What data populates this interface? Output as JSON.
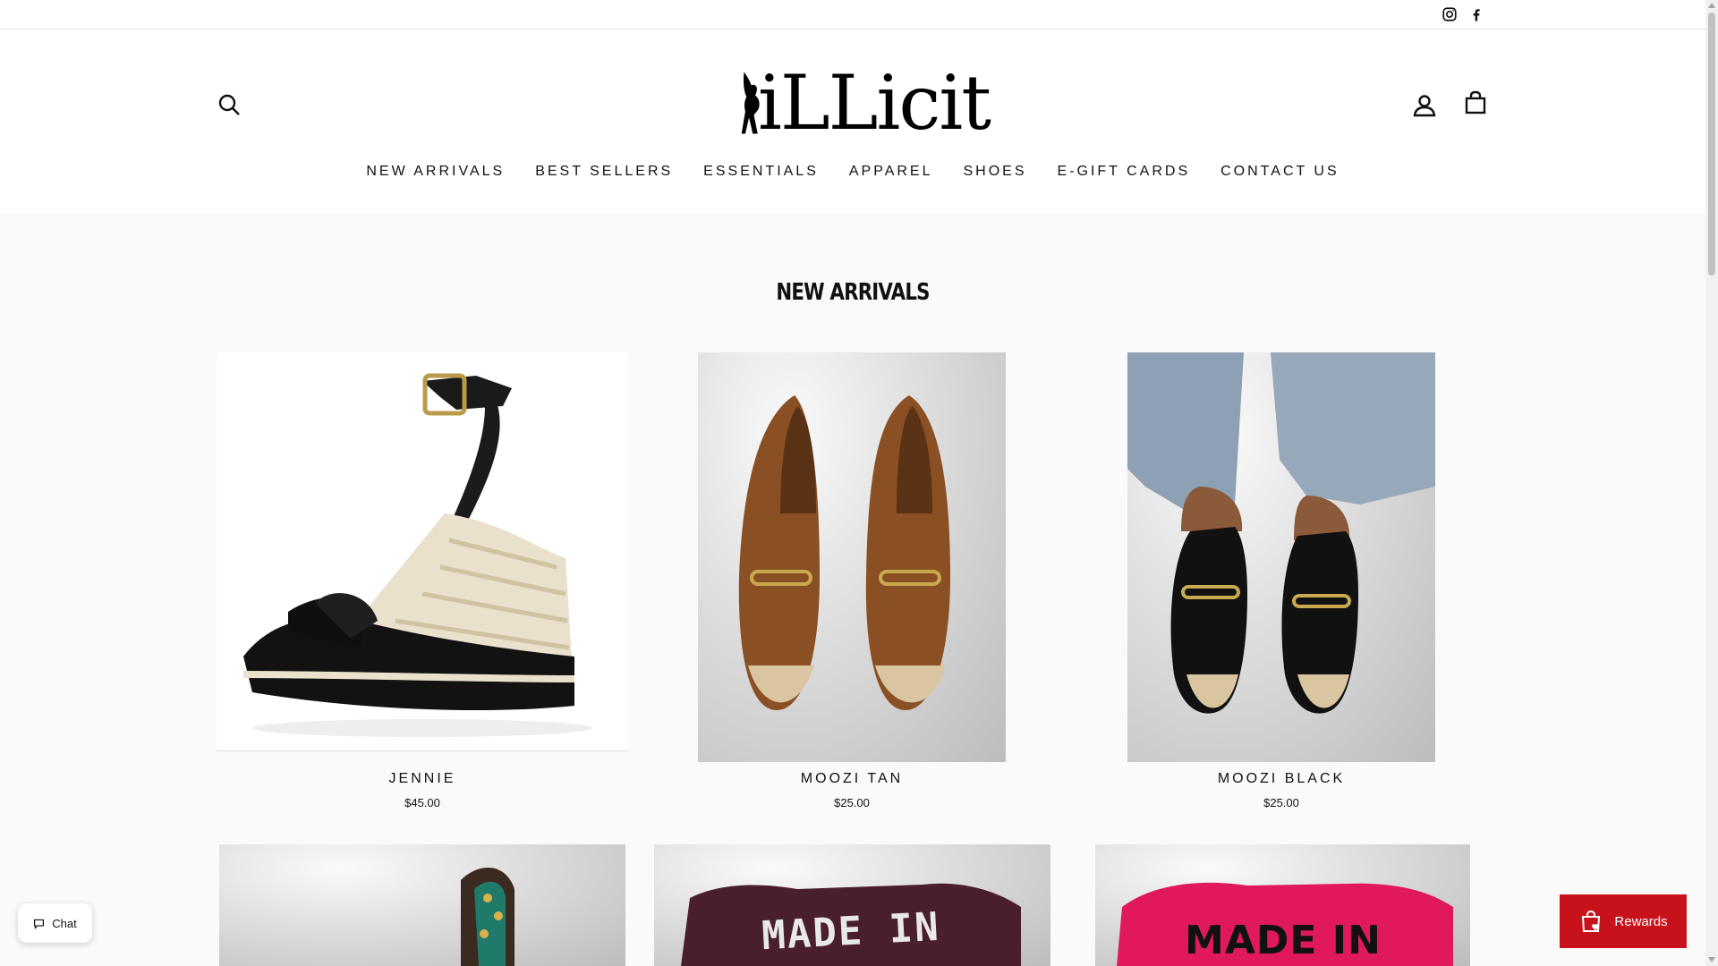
{
  "announcement": {
    "social": [
      {
        "name": "instagram-icon"
      },
      {
        "name": "facebook-icon"
      }
    ]
  },
  "header": {
    "logo_text": "iLLicit",
    "nav": [
      "NEW ARRIVALS",
      "BEST SELLERS",
      "ESSENTIALS",
      "APPAREL",
      "SHOES",
      "E-GIFT CARDS",
      "CONTACT US"
    ]
  },
  "section": {
    "title": "NEW ARRIVALS"
  },
  "products": [
    {
      "title": "JENNIE",
      "price": "$45.00"
    },
    {
      "title": "MOOZI TAN",
      "price": "$25.00"
    },
    {
      "title": "MOOZI BLACK",
      "price": "$25.00"
    }
  ],
  "lower_products": [
    {
      "image_text": "MADE IN"
    },
    {
      "image_text": "MADE IN"
    }
  ],
  "widgets": {
    "chat_label": "Chat",
    "rewards_label": "Rewards"
  },
  "colors": {
    "rewards_bg": "#c8121b",
    "page_bg": "#fbfafa"
  }
}
